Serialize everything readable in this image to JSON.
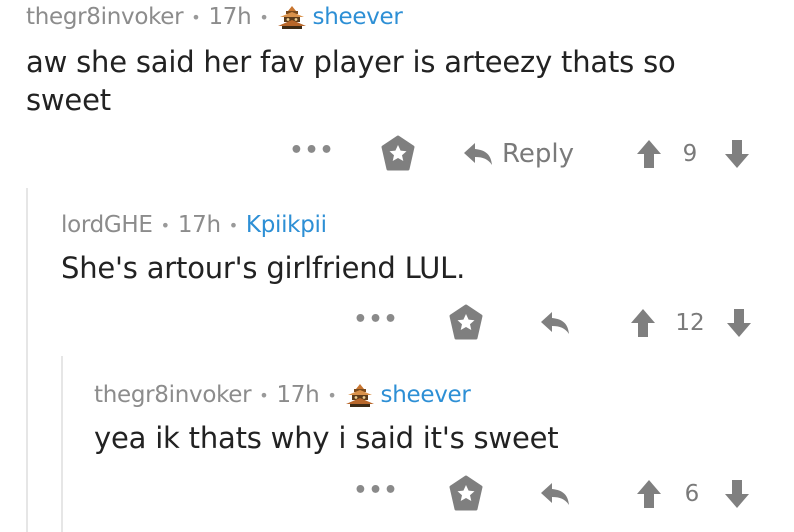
{
  "comments": [
    {
      "author": "thegr8invoker",
      "time": "17h",
      "flair": "sheever",
      "flair_icon": "pagoda-flair-icon",
      "body": "aw she said her fav player is arteezy thats so sweet",
      "reply_label": "Reply",
      "score": "9"
    },
    {
      "author": "lordGHE",
      "time": "17h",
      "flair": "Kpiikpii",
      "body": "She's artour's girlfriend LUL.",
      "score": "12"
    },
    {
      "author": "thegr8invoker",
      "time": "17h",
      "flair": "sheever",
      "flair_icon": "pagoda-flair-icon",
      "body": "yea ik thats why i said it's sweet",
      "score": "6"
    }
  ],
  "icons": {
    "more": "more-options-icon",
    "gild": "gild-star-icon",
    "reply": "reply-arrow-icon",
    "upvote": "upvote-arrow-icon",
    "downvote": "downvote-arrow-icon"
  },
  "colors": {
    "meta_text": "#8c8c8c",
    "flair_link": "#2d8fd5",
    "body_text": "#222222",
    "action_icon": "#808080",
    "thread_line": "#e6e6e6"
  },
  "more_glyph": "•••"
}
